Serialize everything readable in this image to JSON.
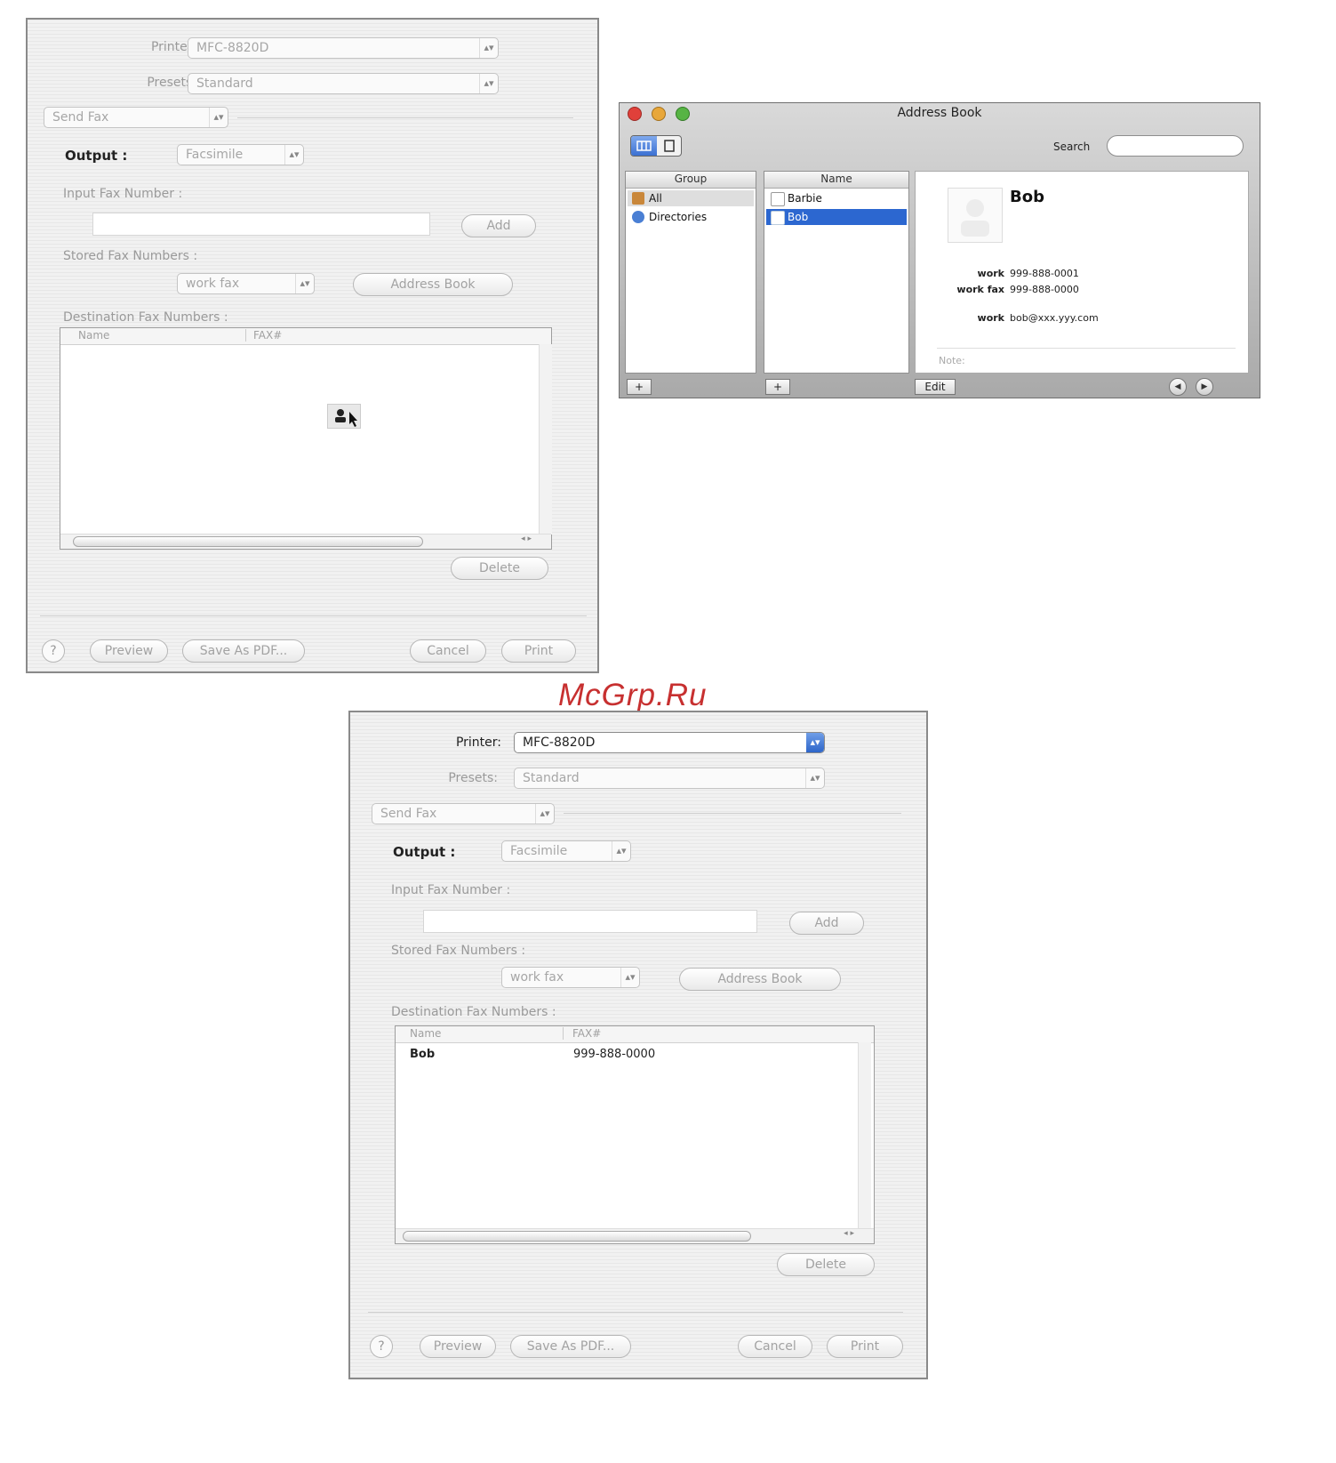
{
  "watermark": "McGrp.Ru",
  "dialog1": {
    "printer_label": "Printer:",
    "printer_value": "MFC-8820D",
    "presets_label": "Presets:",
    "presets_value": "Standard",
    "pane_value": "Send Fax",
    "output_label": "Output :",
    "output_value": "Facsimile",
    "input_fax_label": "Input Fax Number :",
    "input_fax_value": "",
    "add_label": "Add",
    "stored_label": "Stored Fax Numbers :",
    "stored_value": "work fax",
    "address_book_label": "Address Book",
    "destination_label": "Destination Fax Numbers :",
    "col_name": "Name",
    "col_fax": "FAX#",
    "rows": [],
    "delete_label": "Delete",
    "help_label": "?",
    "preview_label": "Preview",
    "save_pdf_label": "Save As PDF...",
    "cancel_label": "Cancel",
    "print_label": "Print"
  },
  "address_book": {
    "title": "Address Book",
    "search_label": "Search",
    "search_value": "",
    "group_header": "Group",
    "name_header": "Name",
    "groups": [
      {
        "label": "All",
        "icon": "address-card-icon",
        "color": "#c9873a"
      },
      {
        "label": "Directories",
        "icon": "globe-icon",
        "color": "#4a7fd4"
      }
    ],
    "names": [
      {
        "label": "Barbie",
        "selected": false
      },
      {
        "label": "Bob",
        "selected": true
      }
    ],
    "card": {
      "name": "Bob",
      "fields": [
        {
          "label": "work",
          "value": "999-888-0001"
        },
        {
          "label": "work fax",
          "value": "999-888-0000"
        },
        {
          "label": "work",
          "value": "bob@xxx.yyy.com"
        }
      ],
      "note_label": "Note:"
    },
    "add_group_label": "+",
    "add_name_label": "+",
    "edit_label": "Edit",
    "colors": {
      "close": "#e0403a",
      "minimize": "#e8a73a",
      "zoom": "#57b444",
      "selection": "#2c67d0"
    }
  },
  "dialog2": {
    "printer_label": "Printer:",
    "printer_value": "MFC-8820D",
    "presets_label": "Presets:",
    "presets_value": "Standard",
    "pane_value": "Send Fax",
    "output_label": "Output :",
    "output_value": "Facsimile",
    "input_fax_label": "Input Fax Number :",
    "input_fax_value": "",
    "add_label": "Add",
    "stored_label": "Stored Fax Numbers :",
    "stored_value": "work fax",
    "address_book_label": "Address Book",
    "destination_label": "Destination Fax Numbers :",
    "col_name": "Name",
    "col_fax": "FAX#",
    "rows": [
      {
        "name": "Bob",
        "fax": "999-888-0000"
      }
    ],
    "delete_label": "Delete",
    "help_label": "?",
    "preview_label": "Preview",
    "save_pdf_label": "Save As PDF...",
    "cancel_label": "Cancel",
    "print_label": "Print"
  }
}
